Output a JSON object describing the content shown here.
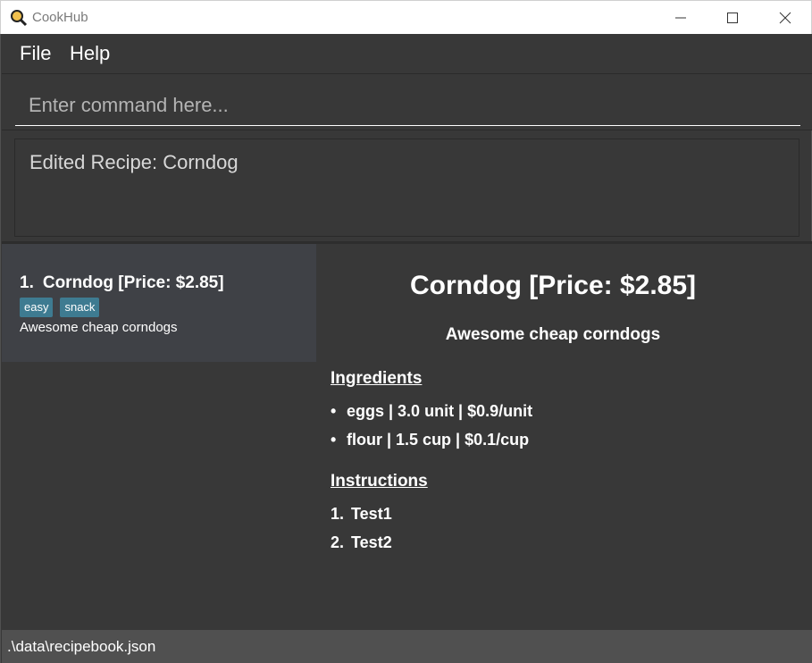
{
  "window": {
    "title": "CookHub"
  },
  "menu": {
    "file": "File",
    "help": "Help"
  },
  "command": {
    "placeholder": "Enter command here...",
    "value": ""
  },
  "result": {
    "message": "Edited Recipe: Corndog"
  },
  "recipe_list": [
    {
      "index": "1.",
      "title": "Corndog [Price: $2.85]",
      "tags": [
        "easy",
        "snack"
      ],
      "description": "Awesome cheap corndogs"
    }
  ],
  "detail": {
    "title": "Corndog [Price: $2.85]",
    "description": "Awesome cheap corndogs",
    "ingredients_heading": "Ingredients",
    "ingredients": [
      "eggs | 3.0 unit | $0.9/unit",
      "flour | 1.5 cup | $0.1/cup"
    ],
    "instructions_heading": "Instructions",
    "instructions": [
      {
        "num": "1.",
        "text": "Test1"
      },
      {
        "num": "2.",
        "text": "Test2"
      }
    ]
  },
  "status": {
    "path": ".\\data\\recipebook.json"
  },
  "colors": {
    "background": "#383838",
    "card": "#3f4146",
    "tag": "#3e7b91",
    "statusbar": "#505050"
  }
}
